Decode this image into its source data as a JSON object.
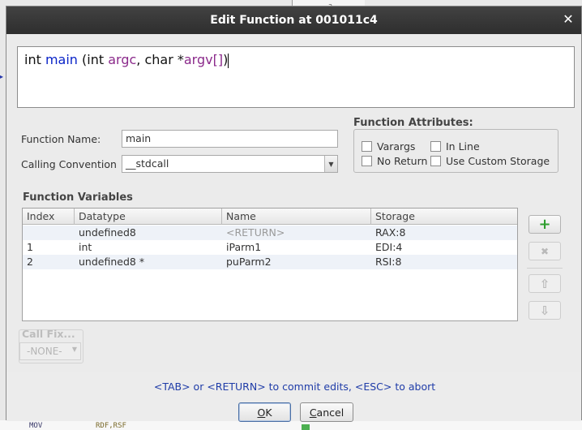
{
  "background": {
    "top_tab_text": "3",
    "bottom_mnemonic": "MOV",
    "bottom_operand": "RDF,RSF"
  },
  "dialog": {
    "title": "Edit Function at 001011c4",
    "close_icon": "close-icon"
  },
  "signature": {
    "ret_type": "int",
    "name": "main",
    "open": " (",
    "p1_type": "int ",
    "p1_name": "argc",
    "sep": ", ",
    "p2_type": "char *",
    "p2_name": "argv[]",
    "close": ")"
  },
  "form": {
    "function_name_label": "Function Name:",
    "function_name_value": "main",
    "calling_convention_label": "Calling Convention",
    "calling_convention_value": "__stdcall"
  },
  "attributes": {
    "title": "Function Attributes:",
    "varargs": {
      "label": "Varargs",
      "checked": false
    },
    "in_line": {
      "label": "In Line",
      "checked": false
    },
    "no_return": {
      "label": "No Return",
      "checked": false
    },
    "custom_storage": {
      "label": "Use Custom Storage",
      "checked": false
    }
  },
  "variables": {
    "title": "Function Variables",
    "columns": [
      "Index",
      "Datatype",
      "Name",
      "Storage"
    ],
    "rows": [
      {
        "index": "",
        "datatype": "undefined8",
        "name": "<RETURN>",
        "storage": "RAX:8"
      },
      {
        "index": "1",
        "datatype": "int",
        "name": "iParm1",
        "storage": "EDI:4"
      },
      {
        "index": "2",
        "datatype": "undefined8 *",
        "name": "puParm2",
        "storage": "RSI:8"
      }
    ]
  },
  "side_buttons": {
    "add": "+",
    "remove": "✖",
    "up": "⇧",
    "down": "⇩"
  },
  "call_fixup": {
    "title": "Call Fix...",
    "value": "-NONE-"
  },
  "status": "<TAB> or <RETURN> to commit edits, <ESC> to abort",
  "buttons": {
    "ok_underlined": "O",
    "ok_rest": "K",
    "cancel_underlined": "C",
    "cancel_rest": "ancel"
  },
  "colors": {
    "accent_link": "#1f3ca8",
    "function_name": "#0a24c8",
    "param_name": "#8b2a8b",
    "add_button": "#2e9e2e"
  }
}
